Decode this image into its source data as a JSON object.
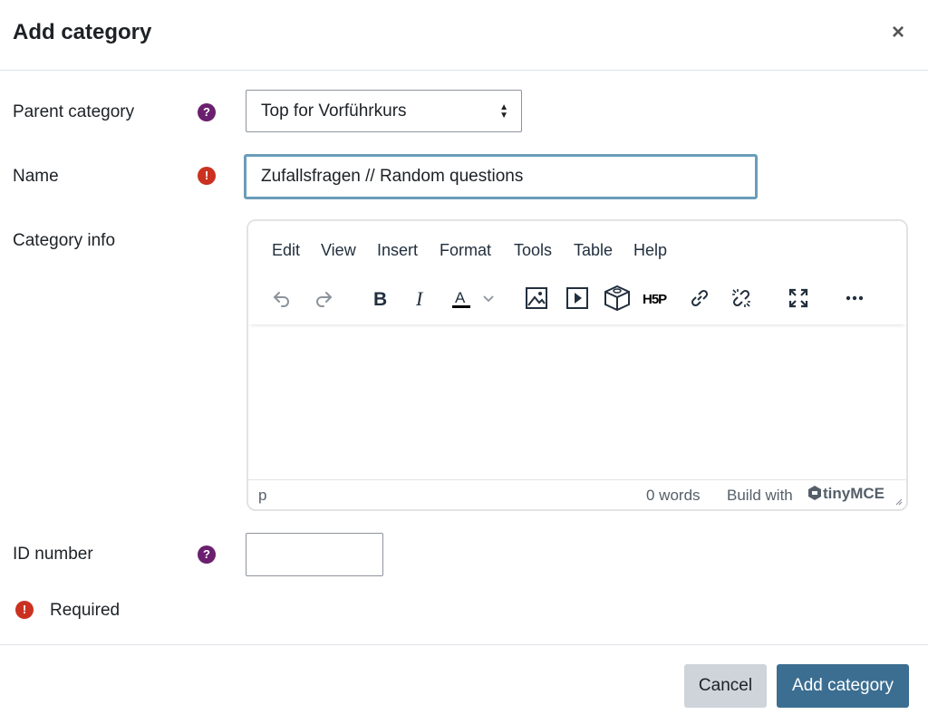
{
  "dialog": {
    "title": "Add category",
    "close_symbol": "×"
  },
  "form": {
    "parent_category": {
      "label": "Parent category",
      "help_symbol": "?",
      "selected": "Top for Vorführkurs"
    },
    "name": {
      "label": "Name",
      "required_symbol": "!",
      "value": "Zufallsfragen // Random questions"
    },
    "category_info": {
      "label": "Category info"
    },
    "id_number": {
      "label": "ID number",
      "help_symbol": "?",
      "value": ""
    },
    "required_note": {
      "symbol": "!",
      "text": "Required"
    }
  },
  "editor": {
    "menu": [
      "Edit",
      "View",
      "Insert",
      "Format",
      "Tools",
      "Table",
      "Help"
    ],
    "toolbar_icons": [
      "undo-icon",
      "redo-icon",
      "bold-icon",
      "italic-icon",
      "text-color-icon",
      "chevron-down-icon",
      "image-icon",
      "media-icon",
      "block-icon",
      "h5p-icon",
      "link-icon",
      "unlink-icon",
      "fullscreen-icon",
      "more-icon"
    ],
    "status": {
      "path": "p",
      "word_count": "0 words",
      "brand": "Build with",
      "logo_text": "tinyMCE"
    }
  },
  "footer": {
    "cancel_label": "Cancel",
    "submit_label": "Add category"
  },
  "colors": {
    "help_badge": "#6b1f6f",
    "required_badge": "#ca3120",
    "primary_button": "#3b6e91",
    "secondary_button": "#ced4da",
    "focus_border": "#6a9dba"
  }
}
